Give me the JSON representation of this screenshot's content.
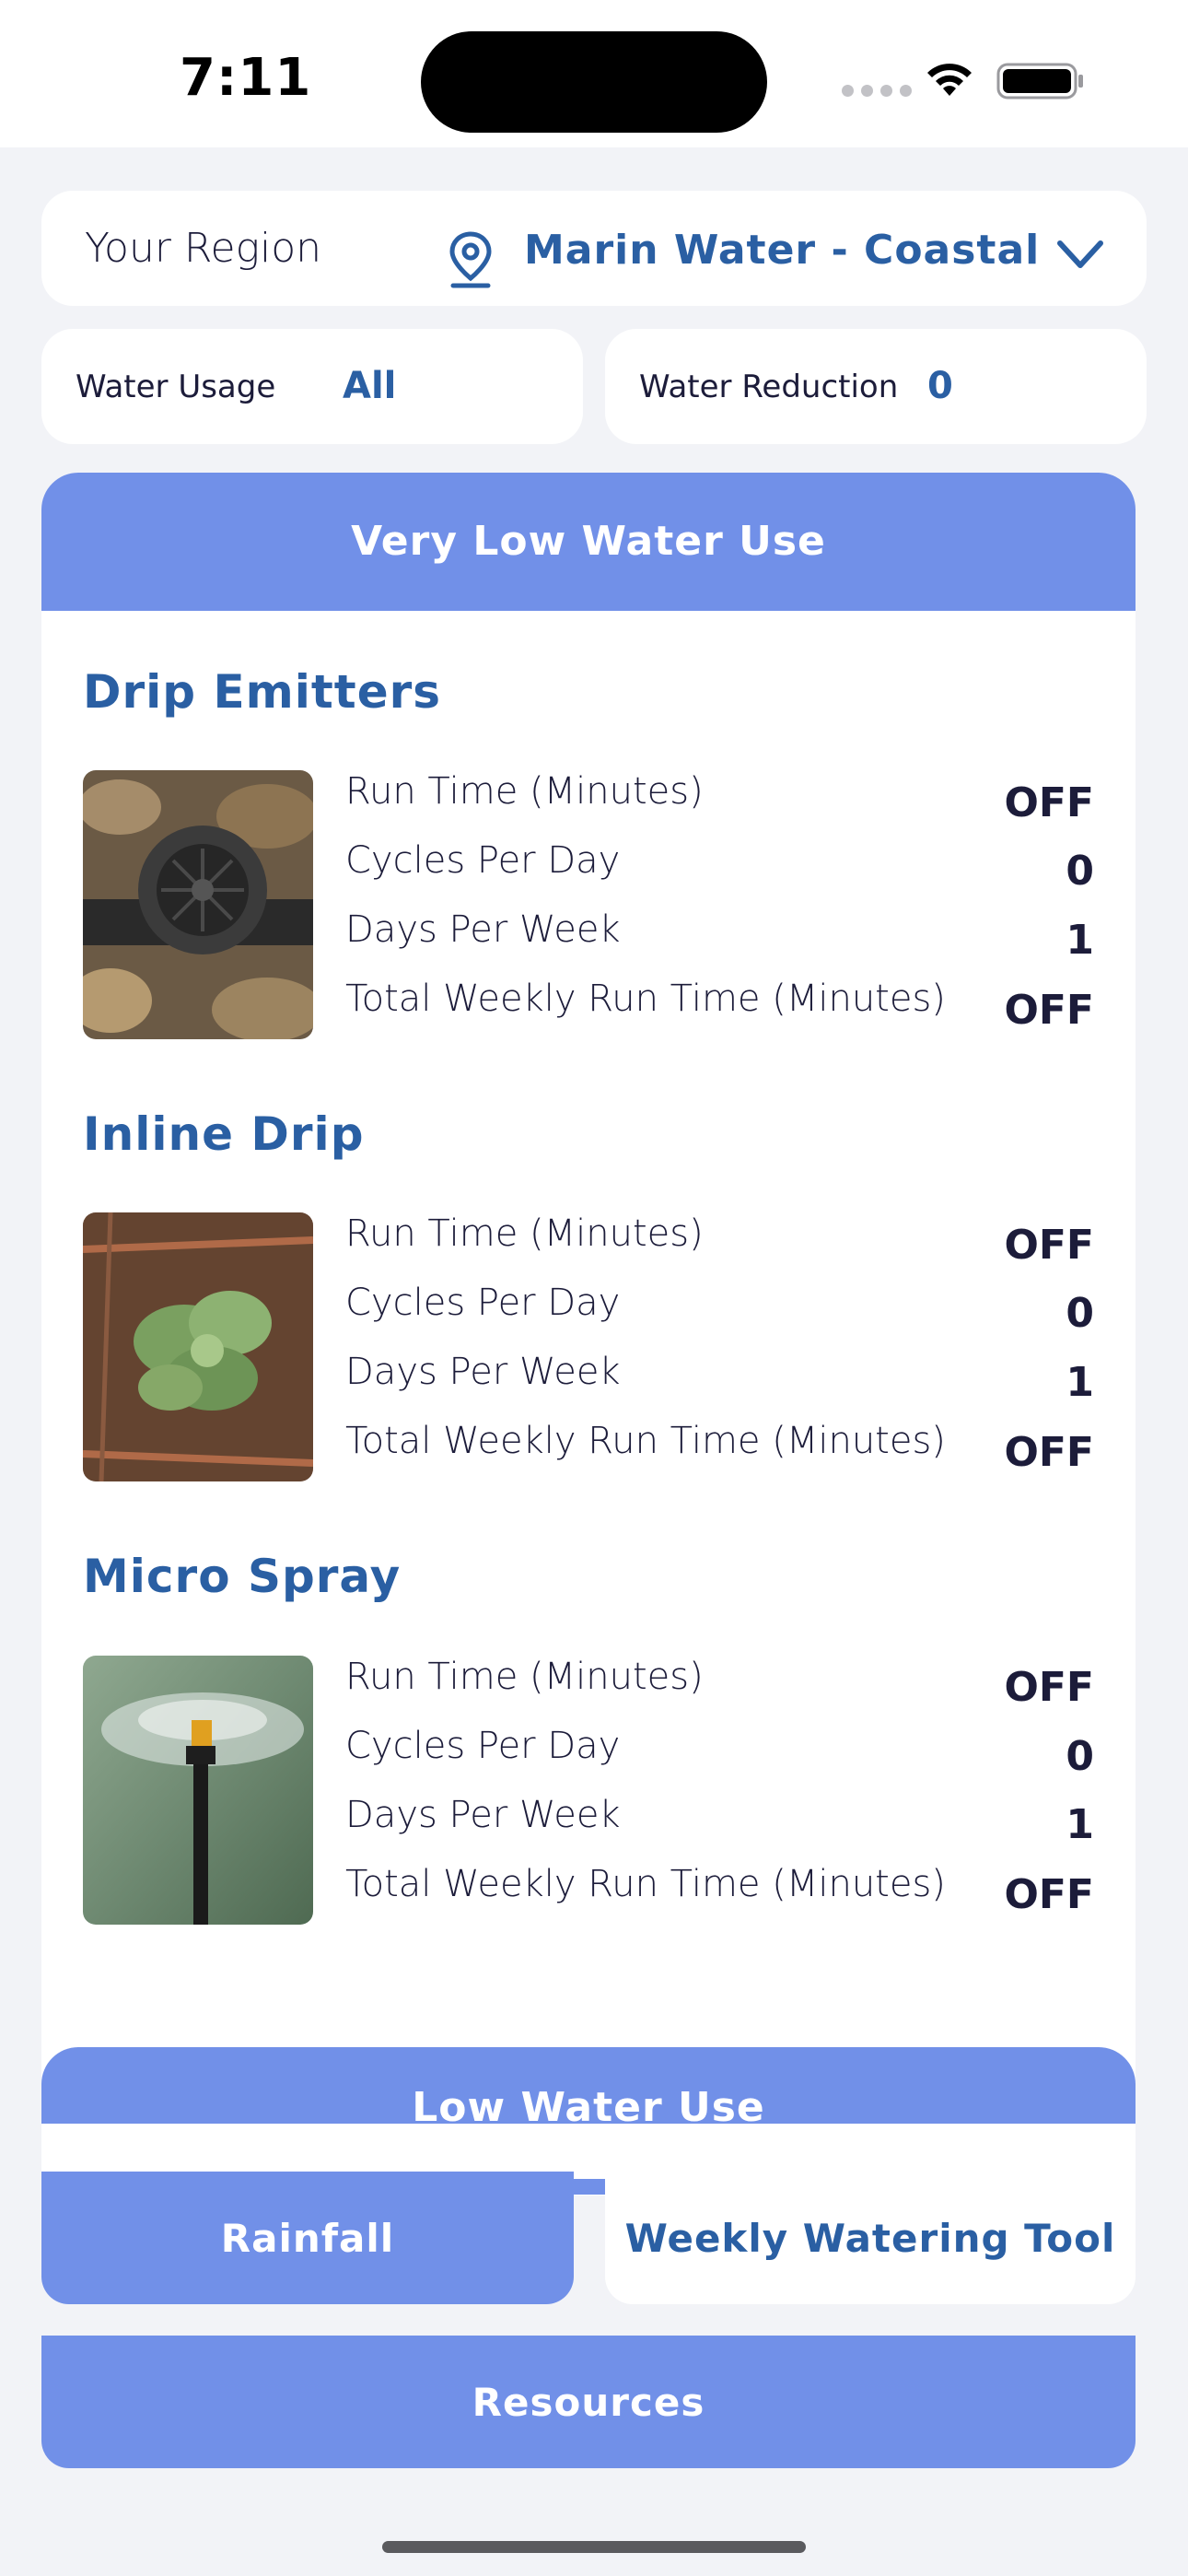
{
  "status_bar": {
    "time": "7:11"
  },
  "region": {
    "label": "Your Region",
    "value": "Marin Water - Coastal"
  },
  "filters": {
    "usage_label": "Water Usage",
    "usage_value": "All",
    "reduction_label": "Water Reduction",
    "reduction_value": "0"
  },
  "section": {
    "title": "Very Low Water Use",
    "plants": [
      {
        "name": "Drip Emitters",
        "image_icon": "drip-emitter-photo",
        "rows": [
          {
            "label": "Run Time (Minutes)",
            "value": "OFF"
          },
          {
            "label": "Cycles Per Day",
            "value": "0"
          },
          {
            "label": "Days Per Week",
            "value": "1"
          },
          {
            "label": "Total Weekly Run Time (Minutes)",
            "value": "OFF"
          }
        ]
      },
      {
        "name": "Inline Drip",
        "image_icon": "inline-drip-photo",
        "rows": [
          {
            "label": "Run Time (Minutes)",
            "value": "OFF"
          },
          {
            "label": "Cycles Per Day",
            "value": "0"
          },
          {
            "label": "Days Per Week",
            "value": "1"
          },
          {
            "label": "Total Weekly Run Time (Minutes)",
            "value": "OFF"
          }
        ]
      },
      {
        "name": "Micro Spray",
        "image_icon": "micro-spray-photo",
        "rows": [
          {
            "label": "Run Time (Minutes)",
            "value": "OFF"
          },
          {
            "label": "Cycles Per Day",
            "value": "0"
          },
          {
            "label": "Days Per Week",
            "value": "1"
          },
          {
            "label": "Total Weekly Run Time (Minutes)",
            "value": "OFF"
          }
        ]
      }
    ]
  },
  "next_section": {
    "title": "Low Water Use"
  },
  "buttons": {
    "rainfall": "Rainfall",
    "weekly_tool": "Weekly Watering Tool",
    "resources": "Resources"
  },
  "colors": {
    "accent": "#7190e8",
    "brand_blue": "#2a5fa3",
    "background": "#f2f3f7"
  }
}
